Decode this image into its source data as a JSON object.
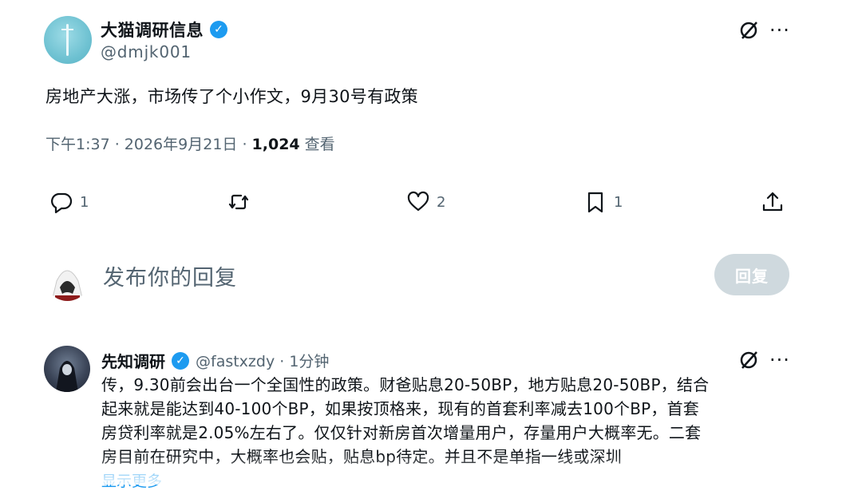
{
  "post": {
    "author_name": "大猫调研信息",
    "author_handle": "@dmjk001",
    "text": "房地产大涨，市场传了个小作文，9月30号有政策",
    "time": "下午1:37 · 2026年9月21日 · ",
    "views": "1,024",
    "views_label": " 查看",
    "actions": {
      "reply_count": "1",
      "repost_count": "",
      "like_count": "2",
      "bookmark_count": "1"
    }
  },
  "composer": {
    "placeholder": "发布你的回复",
    "button_label": "回复"
  },
  "reply": {
    "author_name": "先知调研",
    "author_handle": "@fastxzdy · 1分钟",
    "line1": "传，9.30前会出台一个全国性的政策。财爸贴息20-50BP，地方贴息20-50BP，结合",
    "line2": "起来就是能达到40-100个BP，如果按顶格来，现有的首套利率减去100个BP，首套",
    "line3": "房贷利率就是2.05%左右了。仅仅针对新房首次增量用户，存量用户大概率无。二套",
    "line4": "房目前在研究中，大概率也会贴，贴息bp待定。并且不是单指一线或深圳",
    "show_more": "显示更多"
  },
  "icons": {
    "verified": "verified-badge-icon",
    "grok": "grok-icon",
    "more": "more-icon",
    "reply": "reply-icon",
    "repost": "repost-icon",
    "like": "like-icon",
    "bookmark": "bookmark-icon",
    "share": "share-icon"
  },
  "colors": {
    "accent": "#1d9bf0",
    "secondary_text": "#536471",
    "disabled_button": "#cfd9de"
  }
}
